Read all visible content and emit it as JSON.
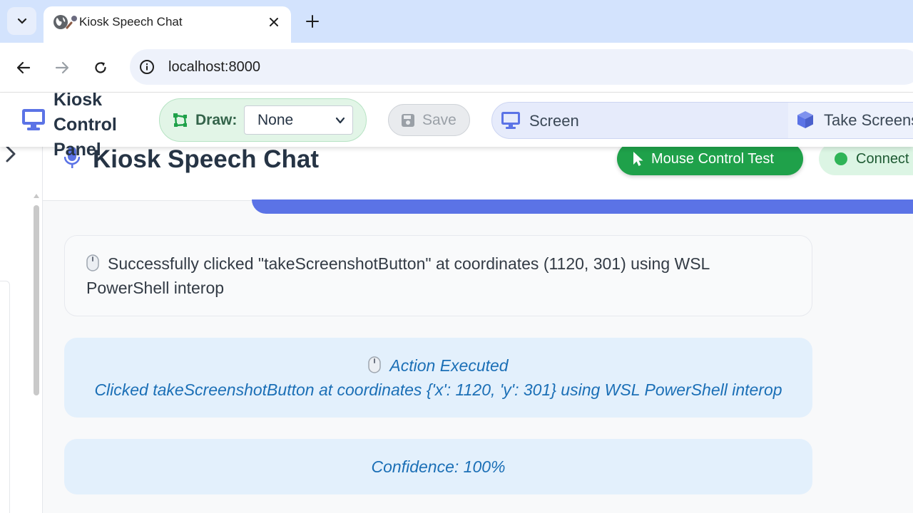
{
  "browser": {
    "tab_title": "Kiosk Speech Chat",
    "url": "localhost:8000"
  },
  "control_panel": {
    "title": "Kiosk Control Panel",
    "draw_label": "Draw:",
    "draw_selected": "None",
    "save_label": "Save",
    "screen_label": "Screen",
    "take_screenshot_label": "Take Screens"
  },
  "chat": {
    "title": "Kiosk Speech Chat",
    "mouse_test_label": "Mouse Control Test",
    "connection_label": "Connect",
    "colors": {
      "mouse_test_bg": "#1fa14a",
      "connection_dot": "#2fb457",
      "progress_bar": "#5b73e6",
      "info_bubble_bg": "#e3f0fc",
      "info_text": "#1b6fb6"
    },
    "messages": [
      {
        "icon": "computer-mouse-icon",
        "text": "Successfully clicked \"takeScreenshotButton\" at coordinates (1120, 301) using WSL PowerShell interop"
      },
      {
        "icon": "computer-mouse-icon",
        "title": "Action Executed",
        "detail": "Clicked takeScreenshotButton at coordinates {'x': 1120, 'y': 301} using WSL PowerShell interop"
      },
      {
        "text": "Confidence: 100%"
      }
    ]
  }
}
